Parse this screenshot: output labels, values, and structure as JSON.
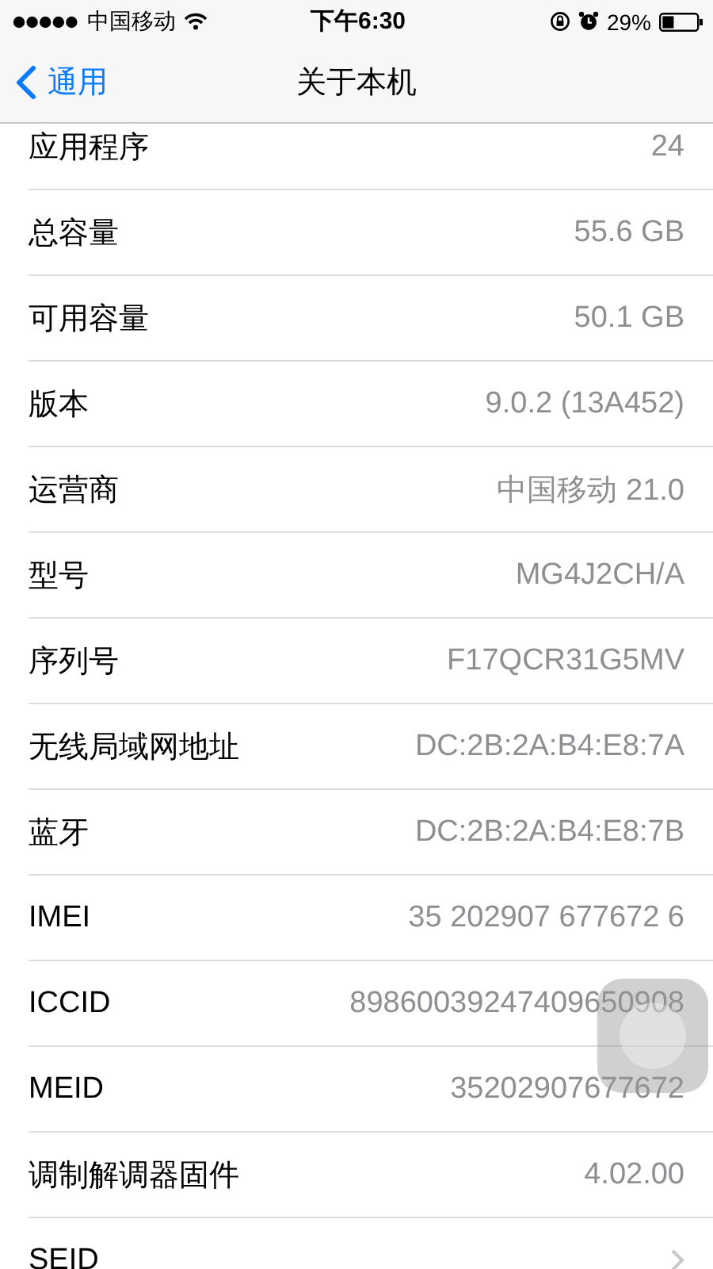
{
  "status_bar": {
    "carrier": "中国移动",
    "time": "下午6:30",
    "battery": "29%"
  },
  "nav_bar": {
    "back": "通用",
    "title": "关于本机"
  },
  "rows": [
    {
      "kind": "value",
      "label": "应用程序",
      "value": "24"
    },
    {
      "kind": "value",
      "label": "总容量",
      "value": "55.6 GB"
    },
    {
      "kind": "value",
      "label": "可用容量",
      "value": "50.1 GB"
    },
    {
      "kind": "value",
      "label": "版本",
      "value": "9.0.2 (13A452)"
    },
    {
      "kind": "value",
      "label": "运营商",
      "value": "中国移动 21.0"
    },
    {
      "kind": "value",
      "label": "型号",
      "value": "MG4J2CH/A"
    },
    {
      "kind": "value",
      "label": "序列号",
      "value": "F17QCR31G5MV"
    },
    {
      "kind": "value",
      "label": "无线局域网地址",
      "value": "DC:2B:2A:B4:E8:7A"
    },
    {
      "kind": "value",
      "label": "蓝牙",
      "value": "DC:2B:2A:B4:E8:7B"
    },
    {
      "kind": "value",
      "label": "IMEI",
      "value": "35 202907 677672 6"
    },
    {
      "kind": "value",
      "label": "ICCID",
      "value": "89860039247409650908"
    },
    {
      "kind": "value",
      "label": "MEID",
      "value": "35202907677672"
    },
    {
      "kind": "value",
      "label": "调制解调器固件",
      "value": "4.02.00"
    },
    {
      "kind": "link",
      "label": "SEID"
    }
  ]
}
